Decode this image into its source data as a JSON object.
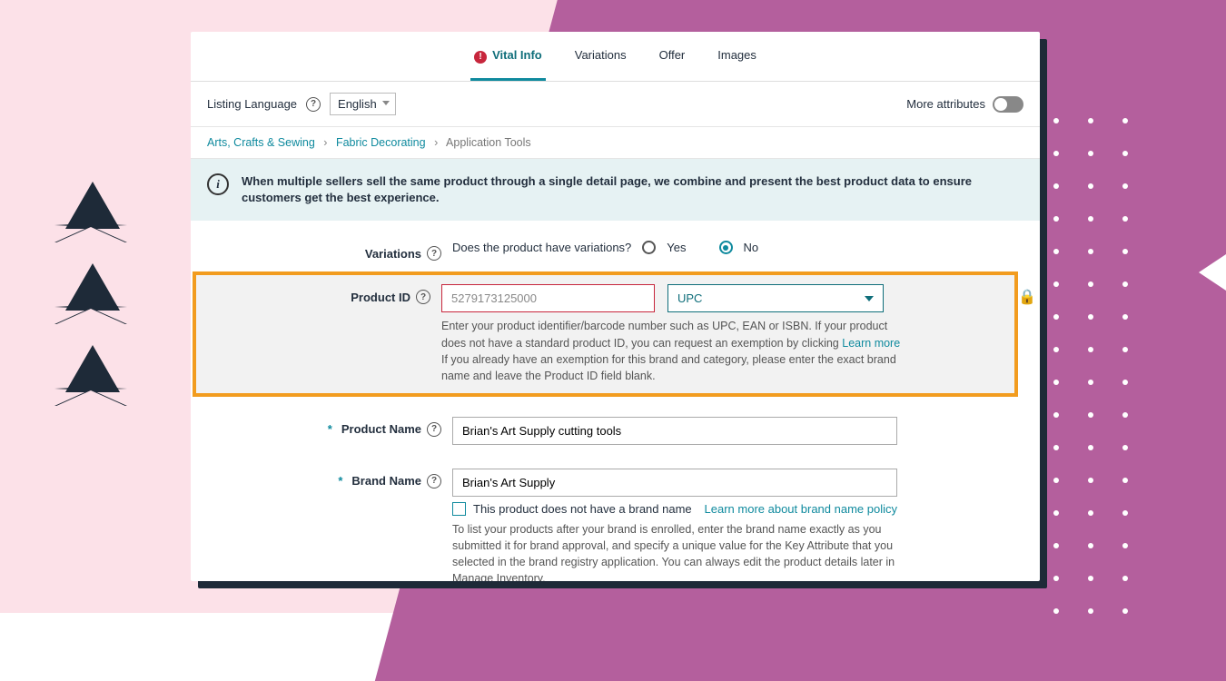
{
  "tabs": {
    "vital": "Vital Info",
    "variations": "Variations",
    "offer": "Offer",
    "images": "Images"
  },
  "langbar": {
    "label": "Listing Language",
    "value": "English",
    "more": "More attributes"
  },
  "crumbs": {
    "a": "Arts, Crafts & Sewing",
    "b": "Fabric Decorating",
    "c": "Application Tools"
  },
  "info": "When multiple sellers sell the same product through a single detail page, we combine and present the best product data to ensure customers get the best experience.",
  "variations": {
    "label": "Variations",
    "q": "Does the product have variations?",
    "yes": "Yes",
    "no": "No"
  },
  "pid": {
    "label": "Product ID",
    "value": "5279173125000",
    "type": "UPC",
    "help1": "Enter your product identifier/barcode number such as UPC, EAN or ISBN. If your product does not have a standard product ID, you can request an exemption by clicking ",
    "learn": "Learn more",
    "help2": " If you already have an exemption for this brand and category, please enter the exact brand name and leave the Product ID field blank."
  },
  "pname": {
    "label": "Product Name",
    "value": "Brian's Art Supply cutting tools"
  },
  "bname": {
    "label": "Brand Name",
    "value": "Brian's Art Supply",
    "nobrand": "This product does not have a brand name",
    "policy": "Learn more about brand name policy",
    "help": "To list your products after your brand is enrolled, enter the brand name exactly as you submitted it for brand approval, and specify a unique value for the Key Attribute that you selected in the brand registry application. You can always edit the product details later in Manage Inventory."
  }
}
